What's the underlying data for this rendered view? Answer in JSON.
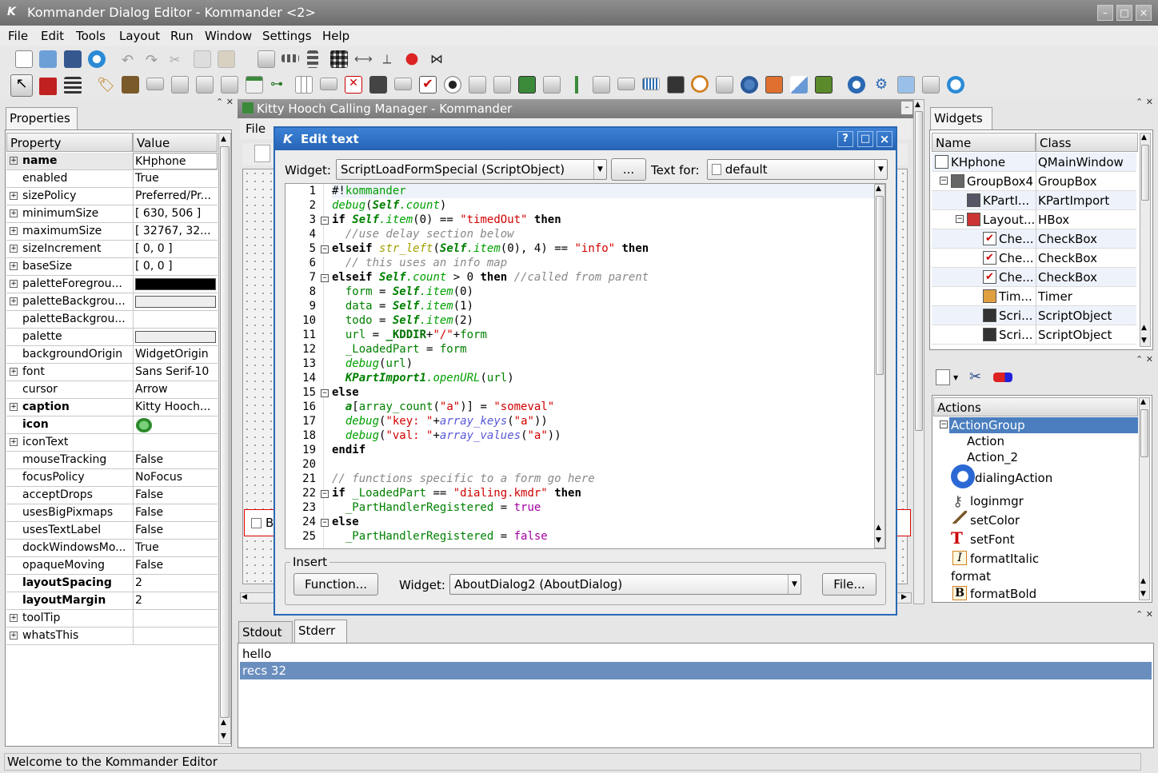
{
  "window": {
    "title": "Kommander Dialog Editor - Kommander <2>",
    "min": "–",
    "max": "□",
    "close": "×"
  },
  "menu": [
    "File",
    "Edit",
    "Tools",
    "Layout",
    "Run",
    "Window",
    "Settings",
    "Help"
  ],
  "properties": {
    "tab": "Properties",
    "col_property": "Property",
    "col_value": "Value",
    "rows": [
      {
        "name": "name",
        "value": "KHphone",
        "bold": true,
        "exp": true
      },
      {
        "name": "enabled",
        "value": "True"
      },
      {
        "name": "sizePolicy",
        "value": "Preferred/Pr...",
        "exp": true
      },
      {
        "name": "minimumSize",
        "value": "[ 630, 506 ]",
        "exp": true
      },
      {
        "name": "maximumSize",
        "value": "[ 32767, 32...",
        "exp": true
      },
      {
        "name": "sizeIncrement",
        "value": "[ 0, 0 ]",
        "exp": true
      },
      {
        "name": "baseSize",
        "value": "[ 0, 0 ]",
        "exp": true
      },
      {
        "name": "paletteForegrou...",
        "value": "",
        "exp": true
      },
      {
        "name": "paletteBackgrou...",
        "value": "",
        "exp": true
      },
      {
        "name": "paletteBackgrou...",
        "value": ""
      },
      {
        "name": "palette",
        "value": ""
      },
      {
        "name": "backgroundOrigin",
        "value": "WidgetOrigin"
      },
      {
        "name": "font",
        "value": "Sans Serif-10",
        "exp": true
      },
      {
        "name": "cursor",
        "value": "Arrow"
      },
      {
        "name": "caption",
        "value": "Kitty Hooch...",
        "bold": true,
        "exp": true
      },
      {
        "name": "icon",
        "value": "",
        "bold": true
      },
      {
        "name": "iconText",
        "value": "",
        "exp": true
      },
      {
        "name": "mouseTracking",
        "value": "False"
      },
      {
        "name": "focusPolicy",
        "value": "NoFocus"
      },
      {
        "name": "acceptDrops",
        "value": "False"
      },
      {
        "name": "usesBigPixmaps",
        "value": "False"
      },
      {
        "name": "usesTextLabel",
        "value": "False"
      },
      {
        "name": "dockWindowsMo...",
        "value": "True"
      },
      {
        "name": "opaqueMoving",
        "value": "False"
      },
      {
        "name": "layoutSpacing",
        "value": "2",
        "bold": true
      },
      {
        "name": "layoutMargin",
        "value": "2",
        "bold": true
      },
      {
        "name": "toolTip",
        "value": "",
        "exp": true
      },
      {
        "name": "whatsThis",
        "value": "",
        "exp": true
      }
    ]
  },
  "form": {
    "title": "Kitty Hooch Calling Manager - Kommander",
    "menu_file": "File",
    "checkbox_label": "B"
  },
  "dialog": {
    "title": "Edit text",
    "help": "?",
    "max": "□",
    "close": "×",
    "widget_label": "Widget:",
    "widget_value": "ScriptLoadFormSpecial (ScriptObject)",
    "dots": "...",
    "textfor_label": "Text for:",
    "textfor_value": "default",
    "insert_label": "Insert",
    "function_btn": "Function...",
    "insert_widget_label": "Widget:",
    "insert_widget_value": "AboutDialog2 (AboutDialog)",
    "file_btn": "File..."
  },
  "widgets": {
    "tab": "Widgets",
    "col_name": "Name",
    "col_class": "Class",
    "rows": [
      {
        "name": "KHphone",
        "cls": "QMainWindow"
      },
      {
        "name": "GroupBox4",
        "cls": "GroupBox"
      },
      {
        "name": "KPartI...",
        "cls": "KPartImport"
      },
      {
        "name": "Layout...",
        "cls": "HBox"
      },
      {
        "name": "Che...",
        "cls": "CheckBox"
      },
      {
        "name": "Che...",
        "cls": "CheckBox"
      },
      {
        "name": "Che...",
        "cls": "CheckBox"
      },
      {
        "name": "Tim...",
        "cls": "Timer"
      },
      {
        "name": "Scri...",
        "cls": "ScriptObject"
      },
      {
        "name": "Scri...",
        "cls": "ScriptObject"
      }
    ]
  },
  "actions": {
    "header": "Actions",
    "items": [
      "ActionGroup",
      "Action",
      "Action_2",
      "dialingAction",
      "loginmgr",
      "setColor",
      "setFont",
      "formatItalic",
      "format",
      "formatBold"
    ]
  },
  "output": {
    "tab_stdout": "Stdout",
    "tab_stderr": "Stderr",
    "lines": [
      "hello",
      "recs 32"
    ]
  },
  "status": "Welcome to the Kommander Editor"
}
